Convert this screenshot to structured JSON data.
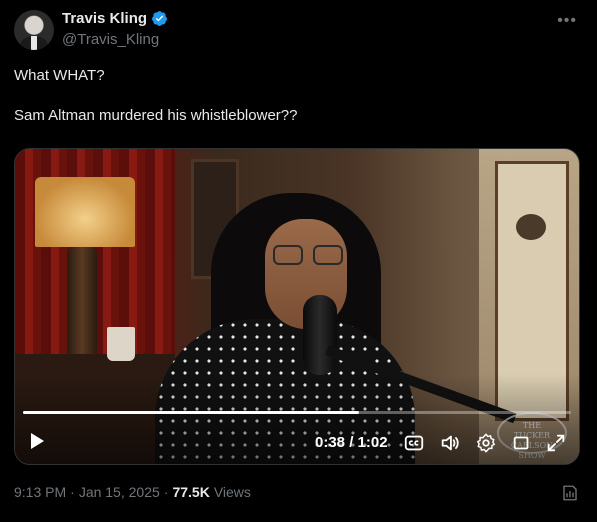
{
  "author": {
    "display_name": "Travis Kling",
    "handle": "@Travis_Kling",
    "verified": true,
    "avatar_icon": "avatar-photo"
  },
  "more_icon": "more-horizontal-icon",
  "tweet": {
    "text": "What WHAT?\n\nSam Altman murdered his whistleblower??"
  },
  "video": {
    "current_time": "0:38",
    "duration": "1:02",
    "time_display": "0:38 / 1:02",
    "progress": 0.613,
    "watermark": "THE TUCKER CARLSON SHOW",
    "controls": [
      "play-icon",
      "captions-icon",
      "volume-icon",
      "settings-icon",
      "fullscreen-icon"
    ]
  },
  "meta": {
    "time": "9:13 PM",
    "separator": "·",
    "date": "Jan 15, 2025",
    "views_count": "77.5K",
    "views_label": "Views",
    "analytics_icon": "analytics-icon"
  },
  "colors": {
    "background": "#000000",
    "text_primary": "#e7e9ea",
    "text_secondary": "#71767b",
    "verified_blue": "#1d9bf0"
  }
}
